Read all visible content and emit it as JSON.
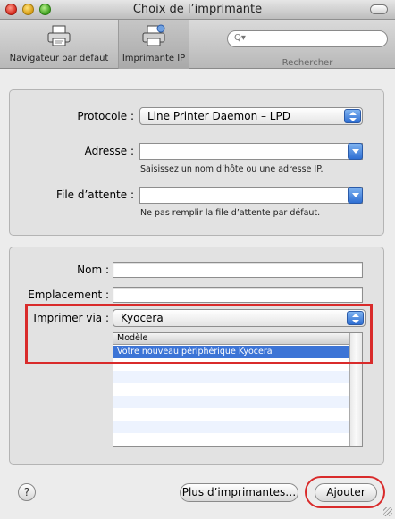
{
  "window": {
    "title": "Choix de l’imprimante"
  },
  "toolbar": {
    "items": [
      {
        "label": "Navigateur par défaut",
        "icon": "printer-icon"
      },
      {
        "label": "Imprimante IP",
        "icon": "network-printer-icon"
      }
    ],
    "search": {
      "label": "Rechercher",
      "placeholder": "Q▾"
    }
  },
  "connection": {
    "protocol_label": "Protocole :",
    "protocol_value": "Line Printer Daemon – LPD",
    "address_label": "Adresse :",
    "address_value": "",
    "address_hint": "Saisissez un nom d’hôte ou une adresse IP.",
    "queue_label": "File d’attente :",
    "queue_value": "",
    "queue_hint": "Ne pas remplir la file d’attente par défaut."
  },
  "printer": {
    "name_label": "Nom :",
    "name_value": "",
    "location_label": "Emplacement :",
    "location_value": "",
    "print_using_label": "Imprimer via :",
    "print_using_value": "Kyocera",
    "model_header": "Modèle",
    "models": [
      "Votre nouveau périphérique Kyocera"
    ]
  },
  "buttons": {
    "help": "?",
    "more_printers": "Plus d’imprimantes…",
    "add": "Ajouter"
  },
  "colors": {
    "annotation": "#d92b2b",
    "selection": "#3c74d6"
  }
}
